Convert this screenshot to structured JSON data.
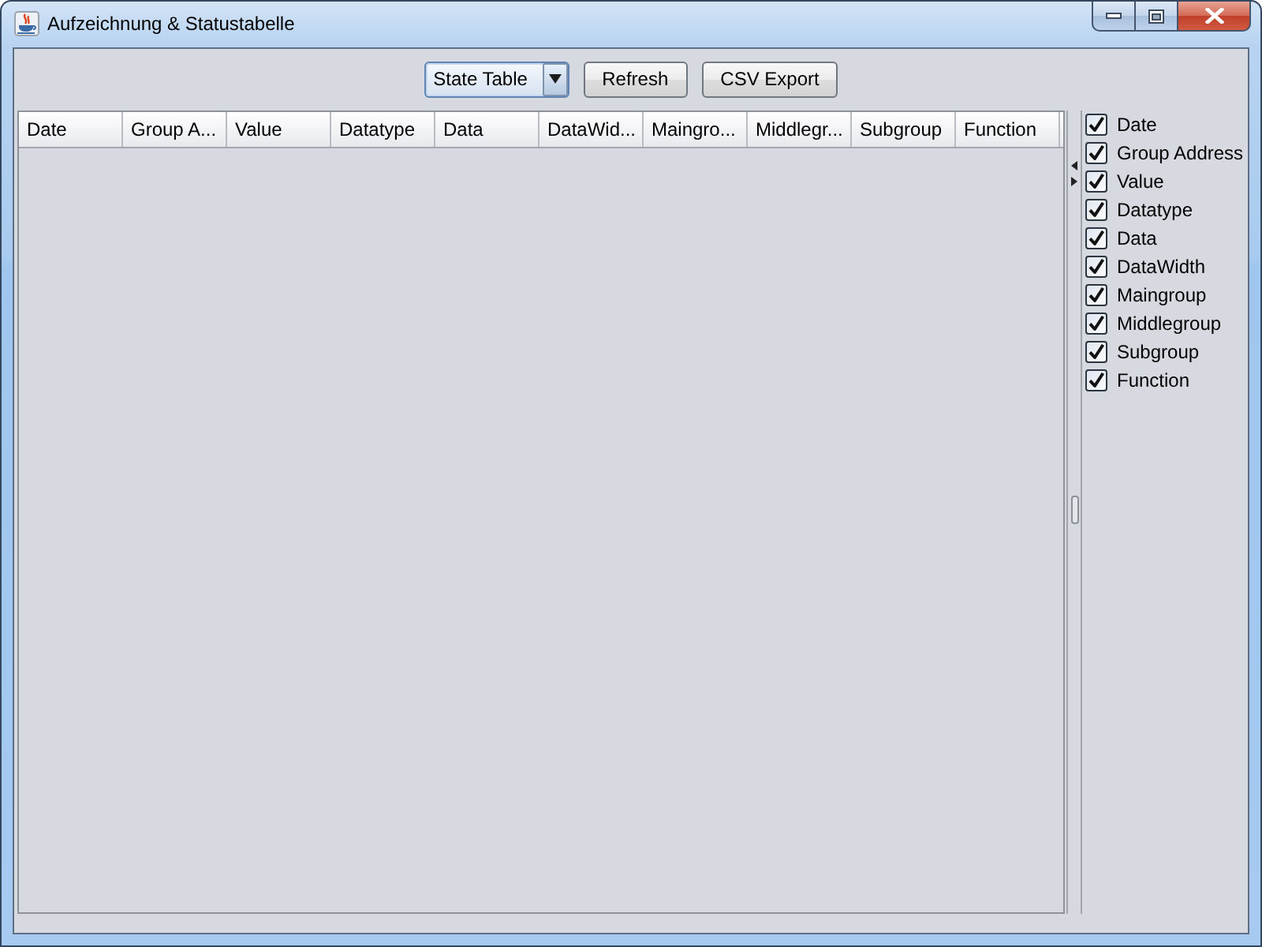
{
  "window": {
    "title": "Aufzeichnung & Statustabelle"
  },
  "toolbar": {
    "view_select": {
      "value": "State Table"
    },
    "buttons": [
      "Refresh",
      "CSV Export"
    ]
  },
  "table": {
    "columns": [
      "Date",
      "Group A...",
      "Value",
      "Datatype",
      "Data",
      "DataWid...",
      "Maingro...",
      "Middlegr...",
      "Subgroup",
      "Function"
    ]
  },
  "column_toggles": [
    {
      "label": "Date",
      "checked": true
    },
    {
      "label": "Group Address",
      "checked": true
    },
    {
      "label": "Value",
      "checked": true
    },
    {
      "label": "Datatype",
      "checked": true
    },
    {
      "label": "Data",
      "checked": true
    },
    {
      "label": "DataWidth",
      "checked": true
    },
    {
      "label": "Maingroup",
      "checked": true
    },
    {
      "label": "Middlegroup",
      "checked": true
    },
    {
      "label": "Subgroup",
      "checked": true
    },
    {
      "label": "Function",
      "checked": true
    }
  ]
}
